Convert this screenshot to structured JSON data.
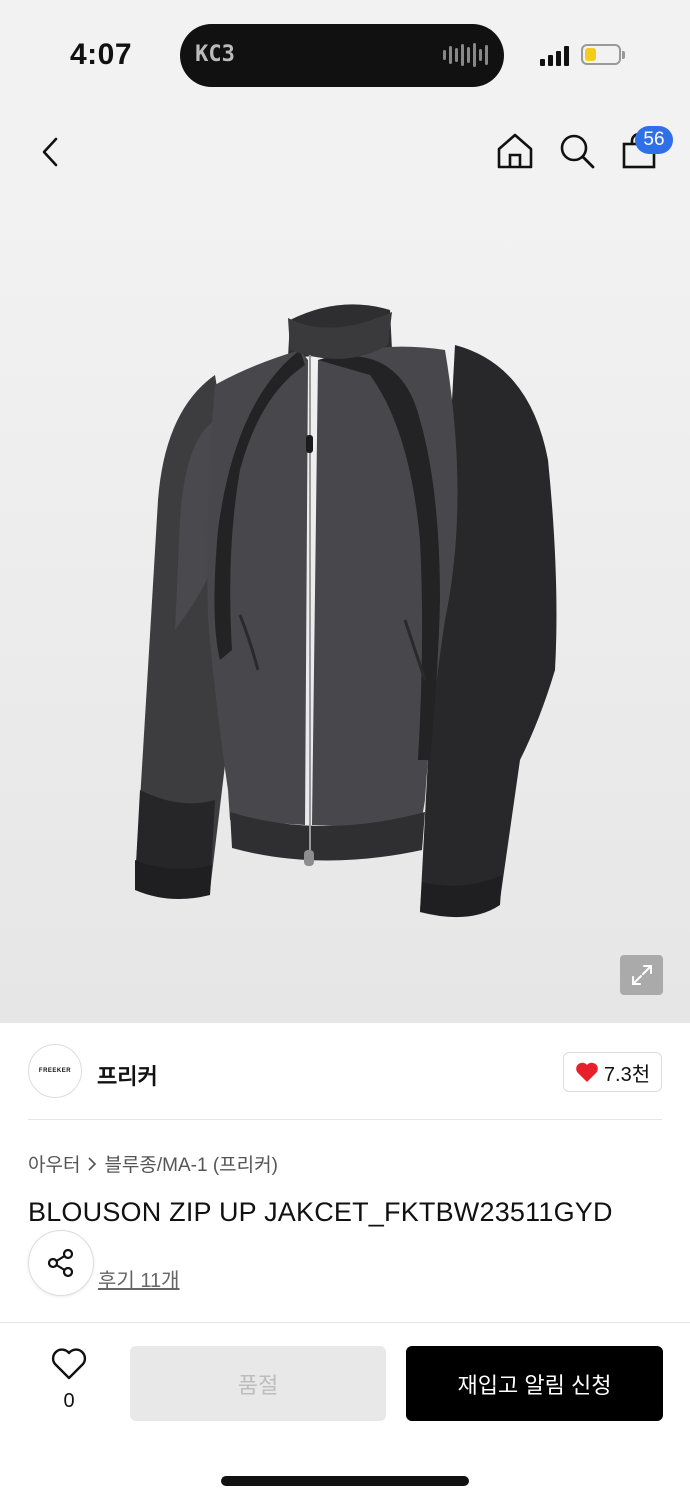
{
  "status_bar": {
    "time": "4:07",
    "island_logo": "KC3",
    "battery_color": "#f4cc1c"
  },
  "header": {
    "back_icon": "chevron-left-icon",
    "home_icon": "home-icon",
    "search_icon": "search-icon",
    "bag_icon": "shopping-bag-icon",
    "cart_badge": "56",
    "badge_color": "#2f6fe8"
  },
  "product_image": {
    "alt": "dark grey blouson zip up jacket",
    "expand_icon": "expand-icon"
  },
  "brand": {
    "logo_text": "FREEKER",
    "name": "프리커",
    "like_icon": "heart-filled-icon",
    "like_count": "7.3천",
    "like_color": "#e8202c"
  },
  "breadcrumb": {
    "category": "아우터",
    "separator_icon": "chevron-right-icon",
    "subcategory": "블루종/MA-1 (프리커)"
  },
  "product": {
    "title": "BLOUSON ZIP UP JAKCET_FKTBW23511GYD",
    "share_icon": "share-icon",
    "review_label": "후기 11개"
  },
  "bottom_bar": {
    "wish_icon": "heart-outline-icon",
    "wish_count": "0",
    "soldout_label": "품절",
    "restock_label": "재입고 알림 신청"
  }
}
